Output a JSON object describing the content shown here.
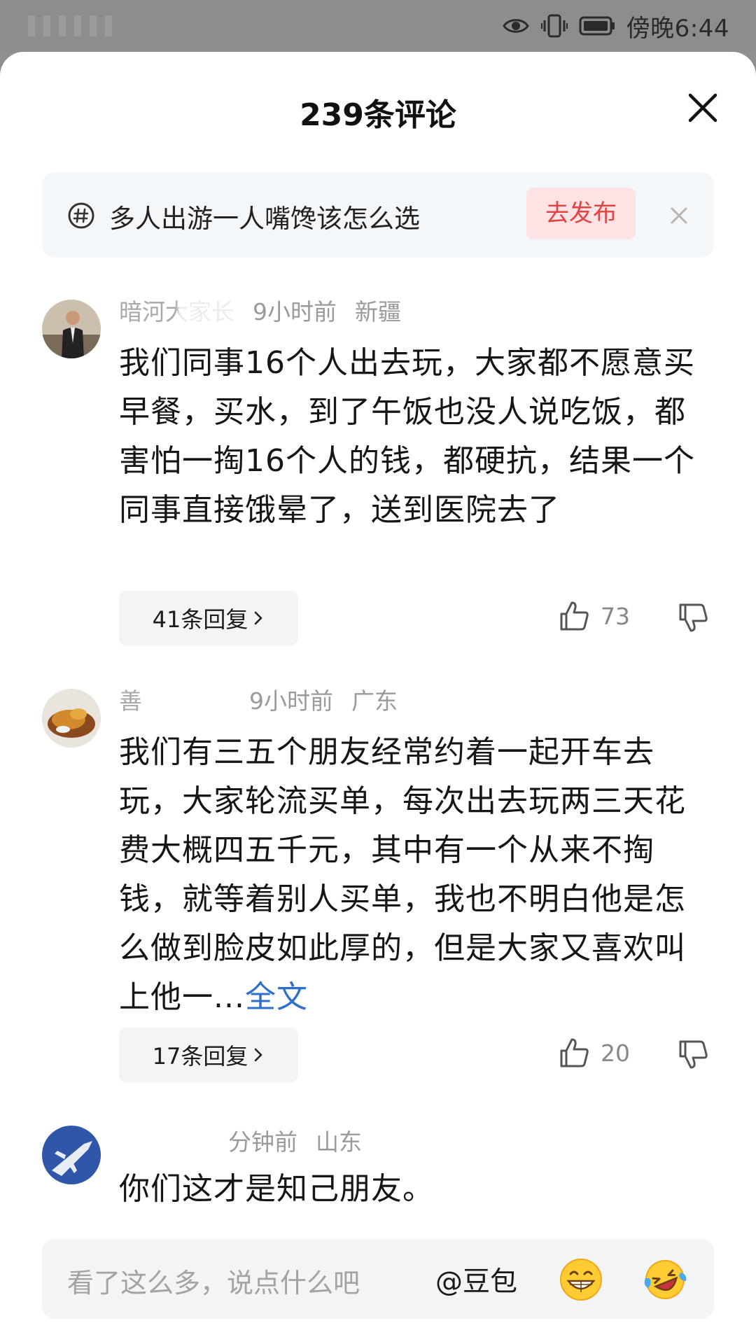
{
  "status_bar": {
    "time": "傍晚6:44"
  },
  "sheet": {
    "title": "239条评论"
  },
  "topic_banner": {
    "topic": "多人出游一人嘴馋该怎么选",
    "publish_label": "去发布"
  },
  "comments": [
    {
      "username": "暗河大家长",
      "time": "9小时前",
      "location": "新疆",
      "text": "我们同事16个人出去玩，大家都不愿意买早餐，买水，到了午饭也没人说吃饭，都害怕一掏16个人的钱，都硬抗，结果一个同事直接饿晕了，送到医院去了",
      "replies": "41条回复",
      "likes": "73"
    },
    {
      "username": "善",
      "time": "9小时前",
      "location": "广东",
      "text": "我们有三五个朋友经常约着一起开车去玩，大家轮流买单，每次出去玩两三天花费大概四五千元，其中有一个从来不掏钱，就等着别人买单，我也不明白他是怎么做到脸皮如此厚的，但是大家又喜欢叫上他一...",
      "full_text_link": "全文",
      "replies": "17条回复",
      "likes": "20"
    },
    {
      "username": "",
      "time": "分钟前",
      "location": "山东",
      "text": "你们这才是知己朋友。"
    }
  ],
  "input_bar": {
    "placeholder": "看了这么多，说点什么吧",
    "mention": "@豆包"
  },
  "colors": {
    "accent_red": "#e24444",
    "link_blue": "#2f6fcb"
  }
}
